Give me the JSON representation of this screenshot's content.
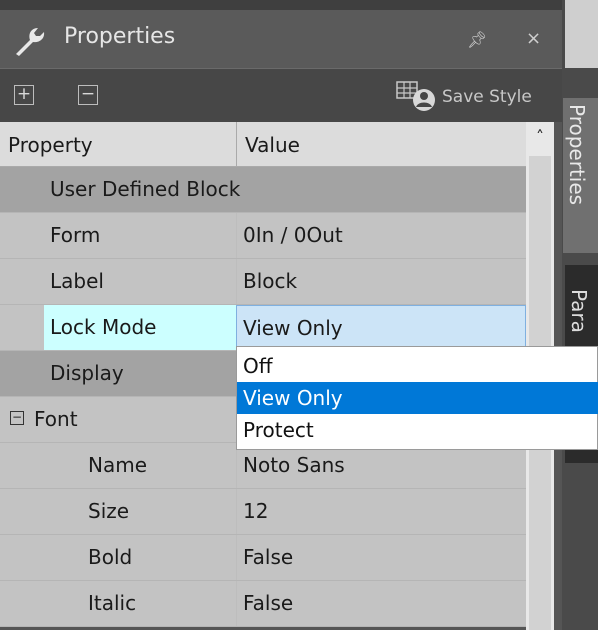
{
  "panel": {
    "title": "Properties",
    "pin_glyph": "📌",
    "close_glyph": "×"
  },
  "toolbar": {
    "expand_glyph": "+",
    "collapse_glyph": "−",
    "save_style_label": "Save Style"
  },
  "side_tabs": {
    "properties": "Properties",
    "parameters": "Para"
  },
  "grid": {
    "headers": {
      "property": "Property",
      "value": "Value"
    },
    "rows": [
      {
        "name": "User Defined Block",
        "value": "",
        "kind": "category"
      },
      {
        "name": "Form",
        "value": "0In / 0Out",
        "kind": "property"
      },
      {
        "name": "Label",
        "value": "Block",
        "kind": "property"
      },
      {
        "name": "Lock Mode",
        "value": "View Only",
        "kind": "selected"
      },
      {
        "name": "Display",
        "value": "",
        "kind": "category"
      },
      {
        "name": "Font",
        "value": "",
        "kind": "group"
      },
      {
        "name": "Name",
        "value": "Noto Sans",
        "kind": "sub"
      },
      {
        "name": "Size",
        "value": "12",
        "kind": "sub"
      },
      {
        "name": "Bold",
        "value": "False",
        "kind": "sub"
      },
      {
        "name": "Italic",
        "value": "False",
        "kind": "sub"
      }
    ]
  },
  "dropdown": {
    "options": [
      "Off",
      "View Only",
      "Protect"
    ],
    "selected": "View Only"
  },
  "colors": {
    "selection": "#0078d7",
    "selected_name_bg": "#ccffff",
    "selected_value_bg": "#cce4f7"
  }
}
